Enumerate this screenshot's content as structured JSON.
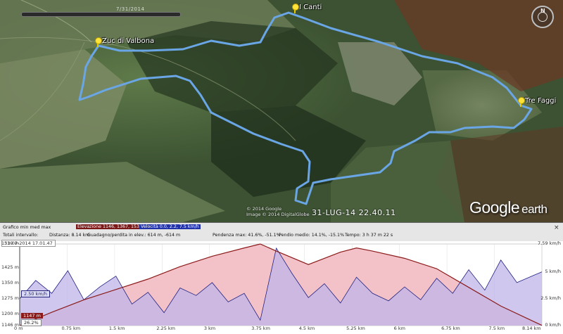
{
  "map": {
    "time_slider_date": "7/31/2014",
    "placemarks": [
      {
        "name": "Zuc di Valbona"
      },
      {
        "name": "I Canti"
      },
      {
        "name": "Tre Faggi"
      }
    ],
    "copyright_lines": [
      "© 2014 Google",
      "Image © 2014 DigitalGlobe"
    ],
    "tour_date": "31-LUG-14 22.40.11",
    "logo": {
      "brand": "Google",
      "product": "earth"
    },
    "compass_label": "N"
  },
  "profile": {
    "header_row1": {
      "grafico_label": "Grafico  min  med  max",
      "elevazione": "Elevazione  1146, 1367, 1539 m",
      "velocita": "Velocità  0.0, 2.2, 7.5 km/h"
    },
    "header_row2": {
      "totali": "Totali intervallo:",
      "distanza": "Distanza: 8.14 km",
      "guadagno": "Guadagno/perdita in elev.:  614 m, -614 m",
      "pendenza_max": "Pendenza max: 41.6%, -51.1%",
      "pendio_medio": "Pendio medio: 14.1%, -15.1%",
      "tempo": "Tempo: 3 h 37 m 22 s"
    },
    "timestamp_badge": "31-07-2014 17.01.47",
    "speed_badge": "2.50 km/h",
    "elev_badge": "1147 m",
    "pct_badge": "26.2%",
    "close_icon": "×",
    "y_left": [
      "1539 m",
      "1425 m",
      "1350 m",
      "1275 m",
      "1200 m",
      "1146 m"
    ],
    "y_right": [
      "7.59 km/h",
      "5 km/h",
      "2.5 km/h",
      "0 km/h"
    ],
    "x_ticks": [
      "0 m",
      "0.75 km",
      "1.5 km",
      "2.25 km",
      "3 km",
      "3.75 km",
      "4.5 km",
      "5.25 km",
      "6 km",
      "6.75 km",
      "7.5 km",
      "8.14 km"
    ]
  },
  "colors": {
    "track": "#6aa6e6",
    "elev_line": "#8b1a1a",
    "elev_fill": "#f3c2c8",
    "speed_fill": "#bfb4e8",
    "speed_line": "#202080"
  },
  "chart_data": {
    "type": "area",
    "title": "",
    "xlabel": "",
    "ylabel": "",
    "x_unit": "km",
    "xlim": [
      0,
      8.14
    ],
    "series": [
      {
        "name": "Elevazione",
        "unit": "m",
        "ylim": [
          1146,
          1539
        ],
        "x": [
          0,
          0.5,
          1.0,
          1.5,
          2.0,
          2.5,
          3.0,
          3.5,
          3.75,
          4.0,
          4.5,
          5.0,
          5.25,
          5.5,
          6.0,
          6.5,
          7.0,
          7.5,
          8.14
        ],
        "values": [
          1146,
          1210,
          1270,
          1320,
          1370,
          1430,
          1480,
          1520,
          1539,
          1505,
          1440,
          1500,
          1520,
          1505,
          1470,
          1420,
          1330,
          1240,
          1147
        ]
      },
      {
        "name": "Velocità",
        "unit": "km/h",
        "ylim": [
          0,
          7.59
        ],
        "x": [
          0,
          0.25,
          0.5,
          0.75,
          1.0,
          1.25,
          1.5,
          1.75,
          2.0,
          2.25,
          2.5,
          2.75,
          3.0,
          3.25,
          3.5,
          3.75,
          4.0,
          4.25,
          4.5,
          4.75,
          5.0,
          5.25,
          5.5,
          5.75,
          6.0,
          6.25,
          6.5,
          6.75,
          7.0,
          7.25,
          7.5,
          7.75,
          8.14
        ],
        "values": [
          2.5,
          4.2,
          3.0,
          5.1,
          2.4,
          3.6,
          4.6,
          2.0,
          3.1,
          1.2,
          3.5,
          2.8,
          4.0,
          2.2,
          3.0,
          0.5,
          7.2,
          4.8,
          2.6,
          3.9,
          2.1,
          4.5,
          3.0,
          2.3,
          3.6,
          2.4,
          4.4,
          3.0,
          5.2,
          3.3,
          6.1,
          4.0,
          5.0
        ]
      }
    ]
  }
}
